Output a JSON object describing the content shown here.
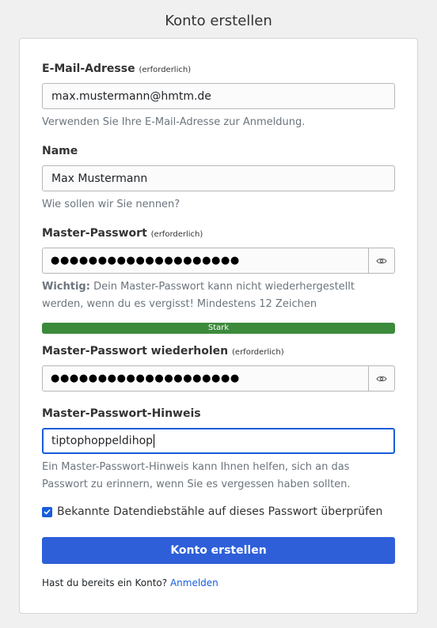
{
  "page_title": "Konto erstellen",
  "email": {
    "label": "E-Mail-Adresse",
    "required": "(erforderlich)",
    "value": "max.mustermann@hmtm.de",
    "help": "Verwenden Sie Ihre E-Mail-Adresse zur Anmeldung."
  },
  "name": {
    "label": "Name",
    "value": "Max Mustermann",
    "help": "Wie sollen wir Sie nennen?"
  },
  "master_password": {
    "label": "Master-Passwort",
    "required": "(erforderlich)",
    "masked": "●●●●●●●●●●●●●●●●●●●●",
    "help_strong": "Wichtig:",
    "help": "Dein Master-Passwort kann nicht wiederhergestellt werden, wenn du es vergisst! Mindestens 12 Zeichen",
    "toggle_icon": "eye-icon"
  },
  "strength": {
    "label": "Stark",
    "fraction": 1.0,
    "color": "#3c8a3c"
  },
  "master_password_repeat": {
    "label": "Master-Passwort wiederholen",
    "required": "(erforderlich)",
    "masked": "●●●●●●●●●●●●●●●●●●●●",
    "toggle_icon": "eye-icon"
  },
  "hint": {
    "label": "Master-Passwort-Hinweis",
    "value": "tiptophoppeldihop",
    "help": "Ein Master-Passwort-Hinweis kann Ihnen helfen, sich an das Passwort zu erinnern, wenn Sie es vergessen haben sollten."
  },
  "breach_check": {
    "label": "Bekannte Datendiebstähle auf dieses Passwort überprüfen",
    "checked": true
  },
  "submit_label": "Konto erstellen",
  "footer": {
    "text": "Hast du bereits ein Konto?",
    "link": "Anmelden"
  },
  "colors": {
    "primary": "#2e5fd9",
    "link": "#175ddc"
  }
}
